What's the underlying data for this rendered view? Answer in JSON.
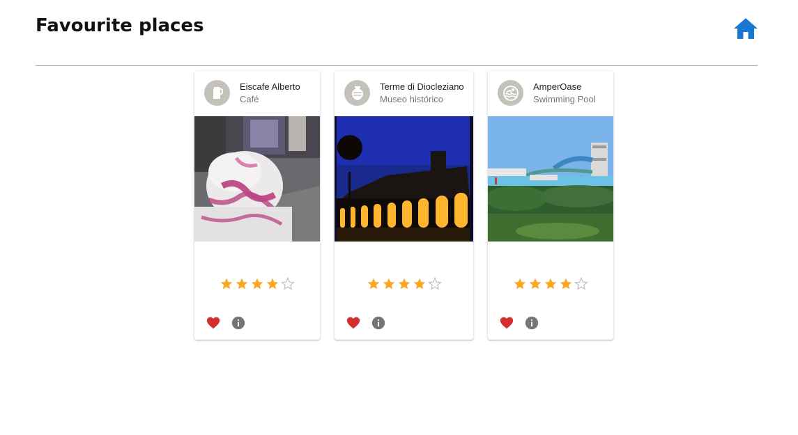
{
  "header": {
    "title": "Favourite places",
    "home_icon": "home-icon"
  },
  "colors": {
    "accent": "#1976d2",
    "star": "#f9a825",
    "star_empty": "#bdbdbd",
    "heart": "#d32f2f",
    "info": "#757575",
    "avatar_bg": "#c4c1bb"
  },
  "places": [
    {
      "name": "Eiscafe Alberto",
      "category": "Café",
      "avatar_icon": "coffee-pot-icon",
      "photo": "ice-cream-photo",
      "rating": 4,
      "max_rating": 5,
      "favourite": true
    },
    {
      "name": "Terme di Diocleziano",
      "category": "Museo histórico",
      "avatar_icon": "amphora-icon",
      "photo": "illuminated-arcade-photo",
      "rating": 4,
      "max_rating": 5,
      "favourite": true
    },
    {
      "name": "AmperOase",
      "category": "Swimming Pool",
      "avatar_icon": "swimming-pool-icon",
      "photo": "waterpark-photo",
      "rating": 4,
      "max_rating": 5,
      "favourite": true
    }
  ]
}
